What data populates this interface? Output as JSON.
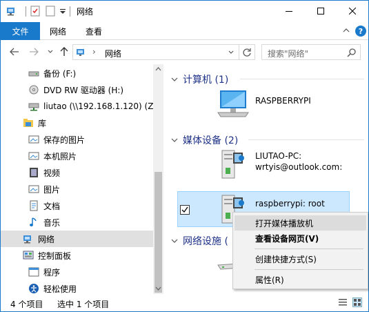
{
  "window": {
    "title": "网络"
  },
  "ribbon": {
    "file_tab": "文件",
    "tabs": [
      "网络",
      "查看"
    ],
    "help_label": "?"
  },
  "address": {
    "path": "网络",
    "separator": "›",
    "search_placeholder": "搜索\"网络\""
  },
  "nav_pane": {
    "items": [
      {
        "label": "备份 (F:)",
        "icon": "drive-icon"
      },
      {
        "label": "DVD RW 驱动器 (H:)",
        "icon": "dvd-icon"
      },
      {
        "label": "liutao (\\\\192.168.1.120) (Z:)",
        "icon": "network-drive-icon"
      },
      {
        "label": "库",
        "icon": "library-icon"
      },
      {
        "label": "保存的图片",
        "icon": "pictures-icon"
      },
      {
        "label": "本机照片",
        "icon": "pictures-icon"
      },
      {
        "label": "视频",
        "icon": "video-icon"
      },
      {
        "label": "图片",
        "icon": "pictures-icon"
      },
      {
        "label": "文档",
        "icon": "documents-icon"
      },
      {
        "label": "音乐",
        "icon": "music-icon"
      },
      {
        "label": "网络",
        "icon": "network-icon"
      },
      {
        "label": "控制面板",
        "icon": "control-panel-icon"
      },
      {
        "label": "程序",
        "icon": "programs-icon"
      },
      {
        "label": "轻松使用",
        "icon": "ease-of-access-icon"
      }
    ],
    "selected_index": 10
  },
  "content": {
    "groups": [
      {
        "header": "计算机 (1)"
      },
      {
        "header": "媒体设备 (2)"
      },
      {
        "header": "网络设施 ("
      }
    ],
    "items": {
      "computer": "RASPBERRYPI",
      "media1_line1": "LIUTAO-PC:",
      "media1_line2": "wrtyis@outlook.com:",
      "media2": "raspberrypi: root"
    }
  },
  "context_menu": {
    "items": [
      "打开媒体播放机",
      "查看设备网页(V)",
      "创建快捷方式(S)",
      "属性(R)"
    ],
    "highlighted_index": 0,
    "bold_index": 1
  },
  "status": {
    "count": "4 个项目",
    "selected": "选中 1 个项目"
  },
  "colors": {
    "accent": "#1979ca",
    "group_header": "#1e3287",
    "selection": "#cce8ff"
  }
}
